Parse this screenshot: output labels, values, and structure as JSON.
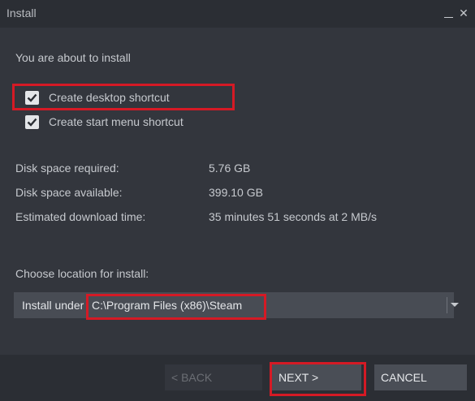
{
  "window": {
    "title": "Install",
    "minimize_glyph": "",
    "close_glyph": "✕"
  },
  "intro": "You are about to install",
  "options": [
    {
      "label": "Create desktop shortcut",
      "checked": true
    },
    {
      "label": "Create start menu shortcut",
      "checked": true
    }
  ],
  "info": [
    {
      "label": "Disk space required:",
      "value": "5.76 GB"
    },
    {
      "label": "Disk space available:",
      "value": "399.10 GB"
    },
    {
      "label": "Estimated download time:",
      "value": "35 minutes 51 seconds at 2 MB/s"
    }
  ],
  "location": {
    "prompt": "Choose location for install:",
    "prefix": "Install under",
    "path": "C:\\Program Files (x86)\\Steam"
  },
  "buttons": {
    "back": "< BACK",
    "next": "NEXT >",
    "cancel": "CANCEL"
  },
  "colors": {
    "highlight": "#d51a25",
    "panel": "#33363d",
    "button": "#4a4e56"
  }
}
